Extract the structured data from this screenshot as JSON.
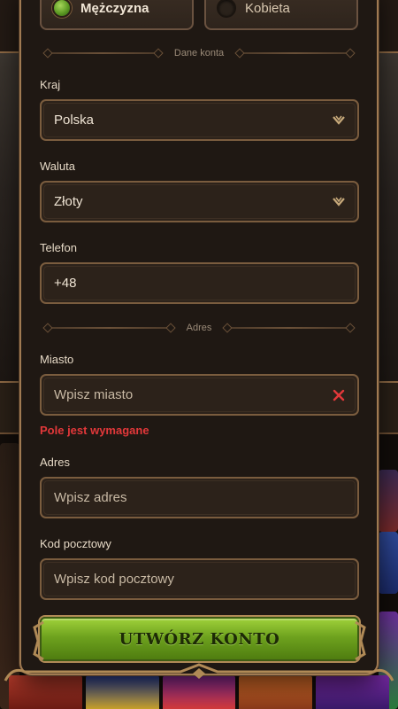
{
  "gender": {
    "male_label": "Mężczyzna",
    "female_label": "Kobieta",
    "selected": "male"
  },
  "sections": {
    "account_details": "Dane konta",
    "address": "Adres"
  },
  "fields": {
    "country": {
      "label": "Kraj",
      "value": "Polska"
    },
    "currency": {
      "label": "Waluta",
      "value": "Złoty"
    },
    "phone": {
      "label": "Telefon",
      "value": "+48"
    },
    "city": {
      "label": "Miasto",
      "placeholder": "Wpisz miasto",
      "error": "Pole jest wymagane"
    },
    "street": {
      "label": "Adres",
      "placeholder": "Wpisz adres"
    },
    "postal": {
      "label": "Kod pocztowy",
      "placeholder": "Wpisz kod pocztowy"
    }
  },
  "submit_label": "UTWÓRZ KONTO",
  "colors": {
    "accent_green": "#7bb024",
    "error_red": "#e2383a",
    "border_gold": "#a07a52",
    "panel_bg": "#1f1813"
  },
  "icons": {
    "dropdown": "chevron-down-icon",
    "clear": "close-icon"
  }
}
